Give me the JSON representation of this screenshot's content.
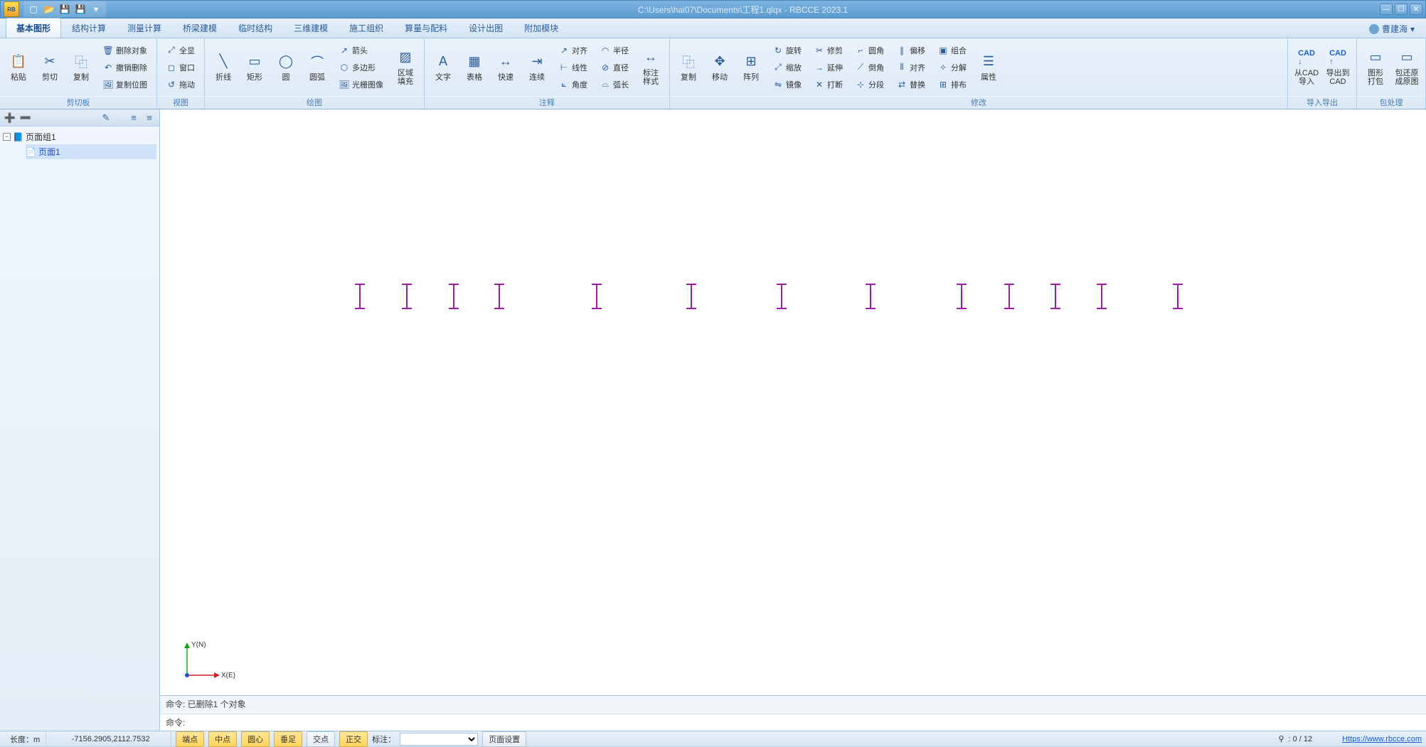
{
  "titlebar": {
    "logo_text": "RB",
    "path": "C:\\Users\\hai07\\Documents\\工程1.qlqx - RBCCE 2023.1"
  },
  "user": {
    "name": "曹建海"
  },
  "tabs": [
    {
      "label": "基本图形",
      "active": true
    },
    {
      "label": "结构计算"
    },
    {
      "label": "测量计算"
    },
    {
      "label": "桥梁建模"
    },
    {
      "label": "临时结构"
    },
    {
      "label": "三维建模"
    },
    {
      "label": "施工组织"
    },
    {
      "label": "算量与配料"
    },
    {
      "label": "设计出图"
    },
    {
      "label": "附加模块"
    }
  ],
  "ribbon_groups": {
    "clipboard": {
      "label": "剪切板",
      "paste": "粘贴",
      "cut": "剪切",
      "copy": "复制",
      "del_obj": "删除对象",
      "undo_del": "撤销删除",
      "copy_bitmap": "复制位图"
    },
    "view": {
      "label": "视图",
      "full": "全显",
      "window": "窗口",
      "drag": "拖动"
    },
    "draw": {
      "label": "绘图",
      "polyline": "折线",
      "rect": "矩形",
      "circle": "圆",
      "arc": "圆弧",
      "arrow": "箭头",
      "polygon": "多边形",
      "raster": "光栅图像",
      "region_fill": "区域\n填充"
    },
    "annotate": {
      "label": "注释",
      "text": "文字",
      "table": "表格",
      "quick": "快速",
      "cont": "连续",
      "align": "对齐",
      "linear": "线性",
      "angle": "角度",
      "radius": "半径",
      "diameter": "直径",
      "arclen": "弧长",
      "dimstyle": "标注\n样式"
    },
    "modify": {
      "label": "修改",
      "copy": "复制",
      "move": "移动",
      "array": "阵列",
      "rotate": "旋转",
      "scale": "缩放",
      "mirror": "镜像",
      "trim": "修剪",
      "extend": "延伸",
      "break": "打断",
      "fillet": "圆角",
      "chamfer": "倒角",
      "segment": "分段",
      "offset": "偏移",
      "align2": "对齐",
      "replace": "替换",
      "group": "组合",
      "ungroup": "分解",
      "arrange": "排布",
      "props": "属性"
    },
    "io": {
      "label": "导入导出",
      "import": "从CAD\n导入",
      "export": "导出到\nCAD"
    },
    "package": {
      "label": "包处理",
      "pack": "图形\n打包",
      "restore": "包还原\n成原图"
    }
  },
  "tree": {
    "root": "页面组1",
    "child": "页面1"
  },
  "ucs": {
    "x": "X(E)",
    "y": "Y(N)"
  },
  "cmdlog_prefix": "命令: ",
  "cmdlog": "已删除1 个对象",
  "cmdprompt": "命令:",
  "status": {
    "length_label": "长度：m",
    "coords": "-7156.2905,2112.7532",
    "snap": {
      "endpoint": "端点",
      "midpoint": "中点",
      "center": "圆心",
      "perp": "垂足",
      "intersect": "交点",
      "ortho": "正交"
    },
    "annotation_label": "标注：",
    "page_settings": "页面设置",
    "counter": ": 0 / 12",
    "url": "Https://www.rbcce.com"
  }
}
